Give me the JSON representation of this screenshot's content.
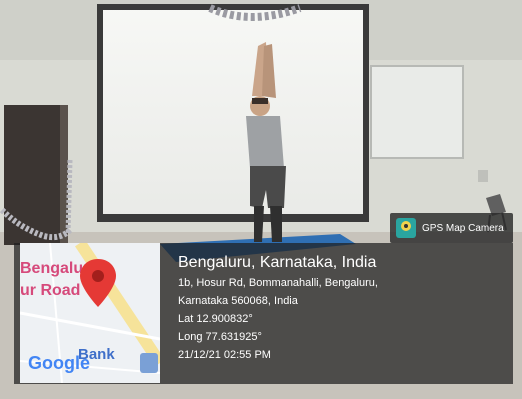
{
  "overlay": {
    "app_badge": "GPS Map Camera",
    "title": "Bengaluru, Karnataka, India",
    "address_line1": "1b, Hosur Rd, Bommanahalli, Bengaluru,",
    "address_line2": "Karnataka 560068, India",
    "latitude": "Lat 12.900832°",
    "longitude": "Long 77.631925°",
    "datetime": "21/12/21 02:55 PM"
  },
  "map": {
    "label_city": "Bengaluru",
    "label_road": "ur Road",
    "label_bank": "Bank",
    "logo": "Google"
  },
  "colors": {
    "pin": "#e53935",
    "map_road": "#f6e39a",
    "mat": "#2f6fb3",
    "panel": "#1e1e1e"
  }
}
